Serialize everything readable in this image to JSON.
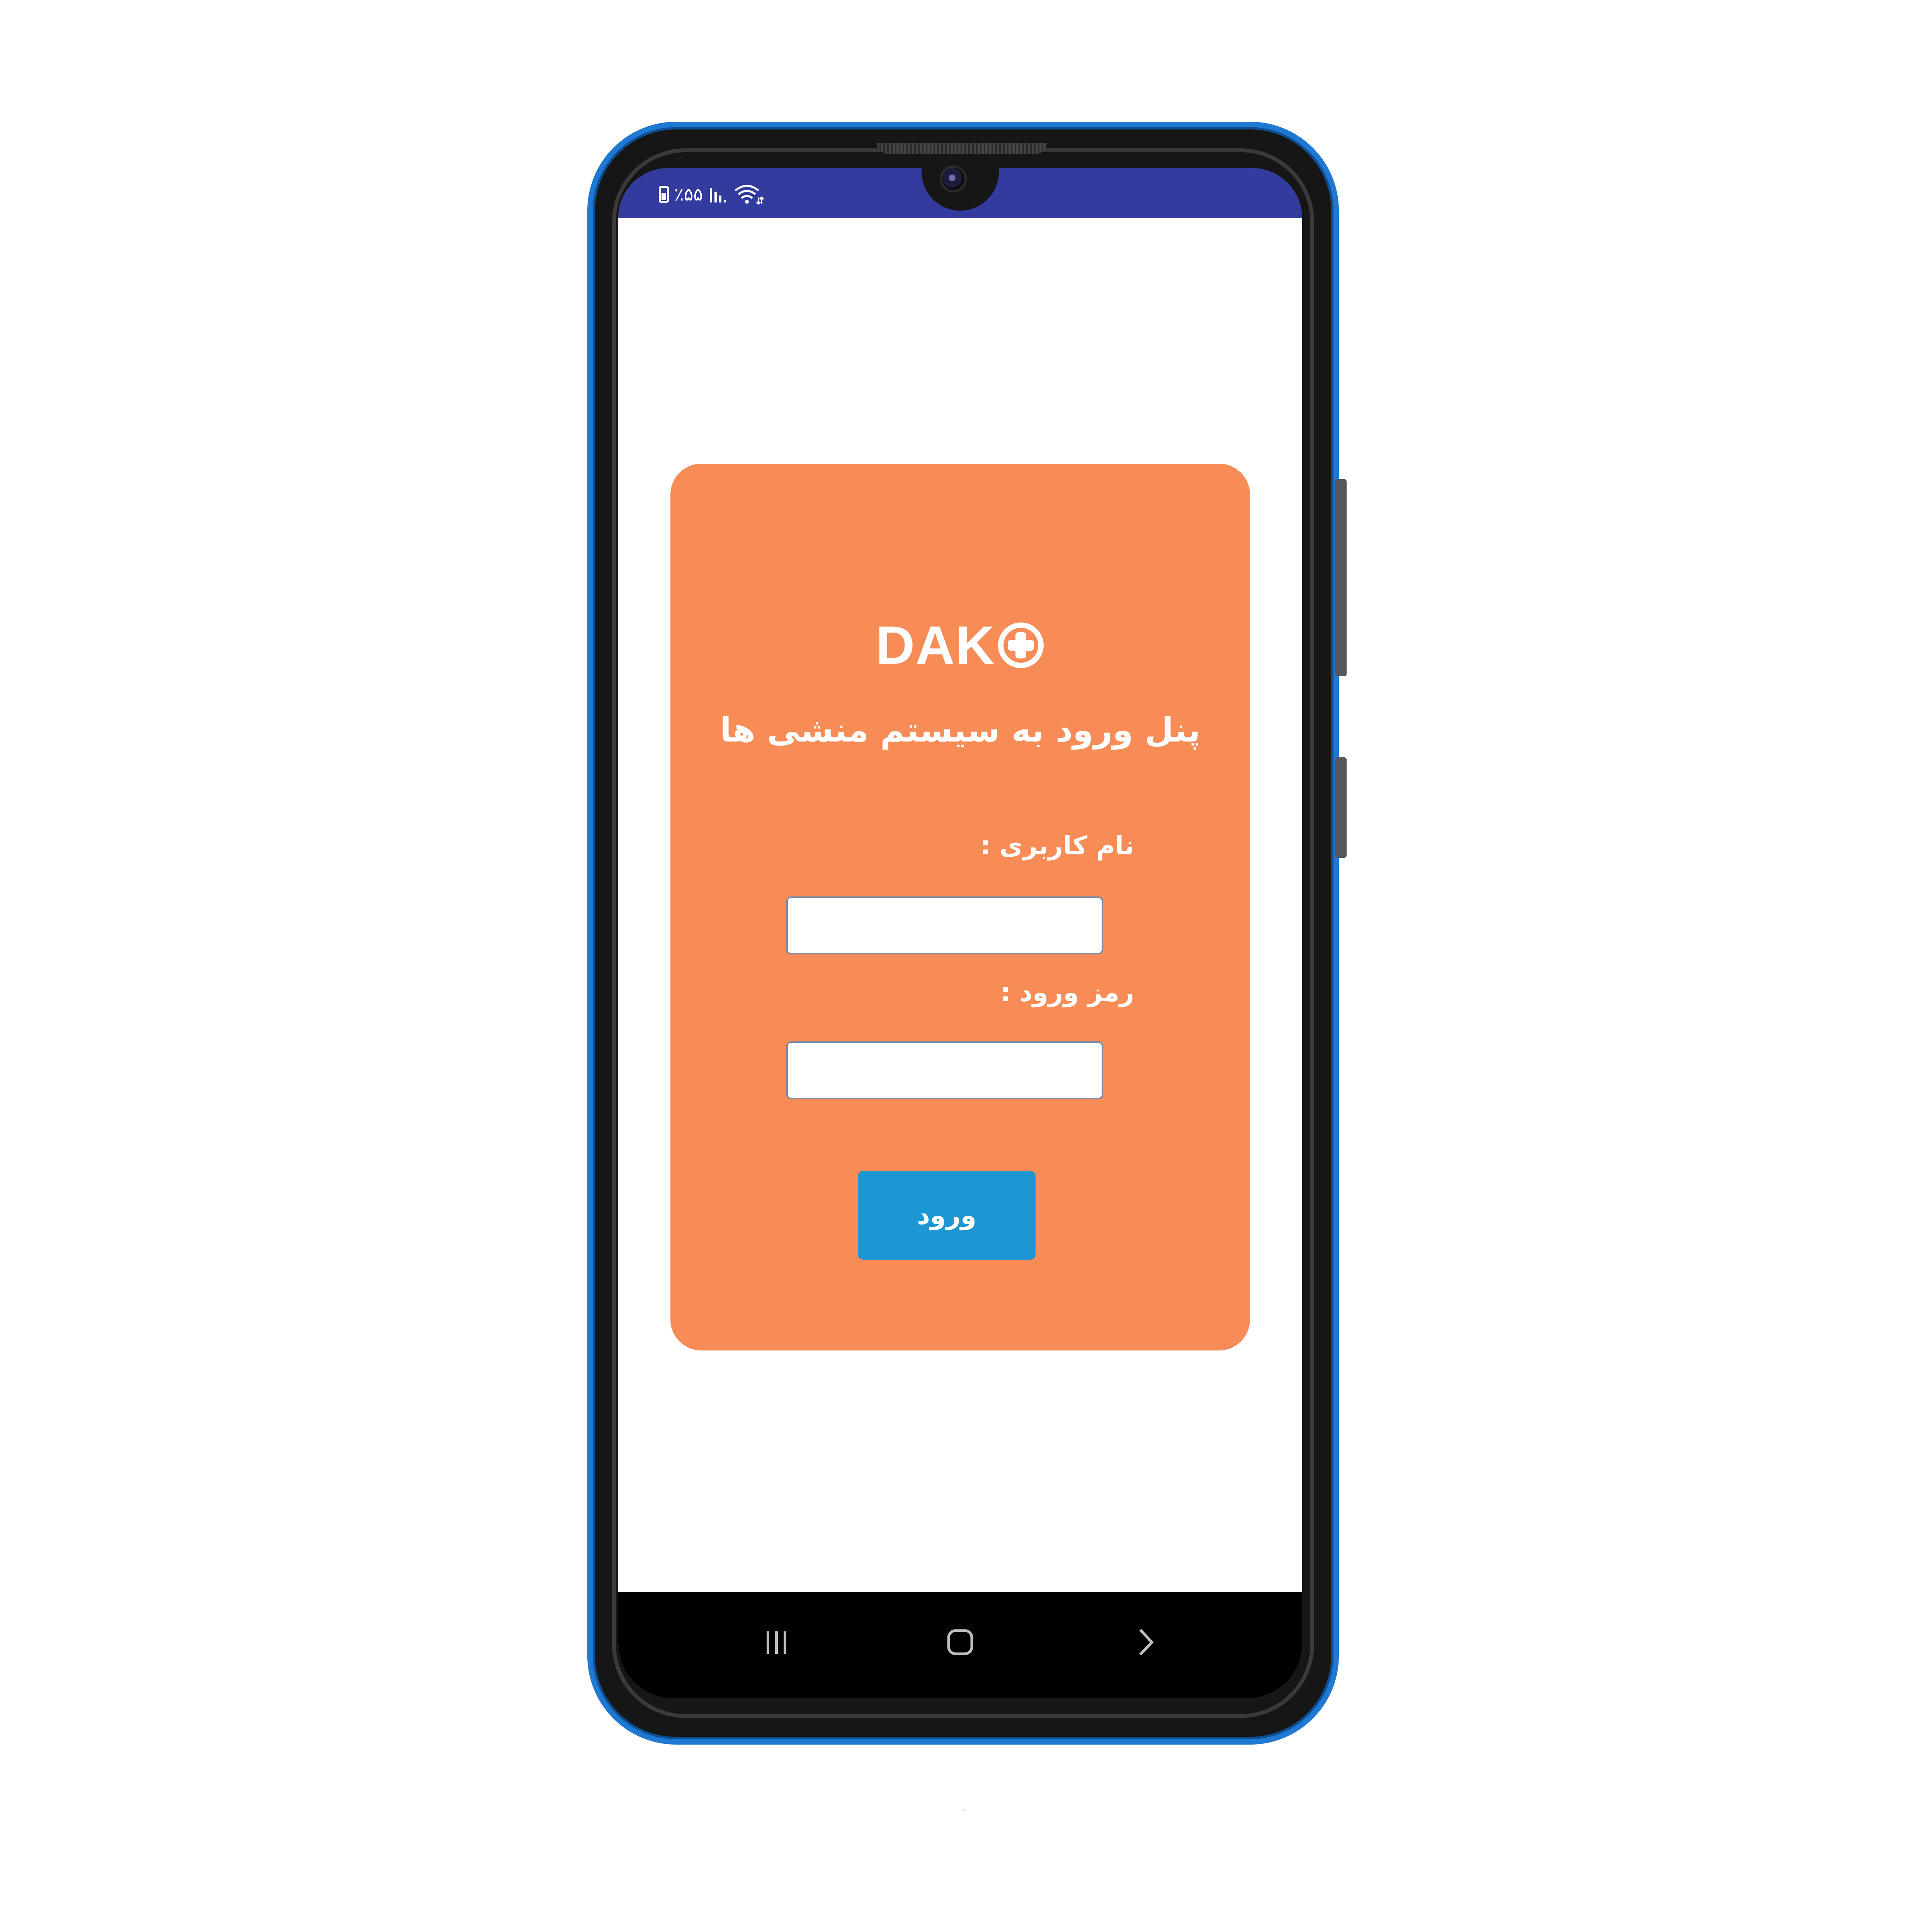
{
  "status_bar": {
    "battery_percent": "٪۵۵",
    "battery_icon": "battery-icon",
    "signal_icon": "signal-icon",
    "wifi_icon": "wifi-icon",
    "background_color": "#333b9e"
  },
  "login_card": {
    "logo_text": "DAK",
    "logo_icon": "medical-cross-circle-icon",
    "title": "پنل ورود به سیستم منشی ها",
    "username_label": "نام کاربری :",
    "username_value": "",
    "password_label": "رمز ورود :",
    "password_value": "",
    "login_button_label": "ورود",
    "background_color": "#f78c56",
    "button_color": "#1c97d4"
  },
  "nav_bar": {
    "recents_icon": "recents-icon",
    "home_icon": "home-icon",
    "back_icon": "back-icon"
  },
  "device": {
    "frame_color": "#1f78d1"
  }
}
